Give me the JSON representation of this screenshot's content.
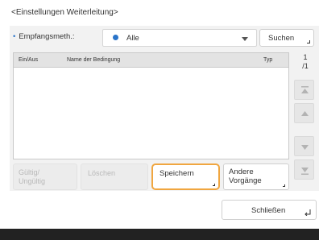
{
  "dialog": {
    "title": "<Einstellungen Weiterleitung>"
  },
  "filter": {
    "label": "Empfangsmeth.:",
    "selected_value": "Alle",
    "search_button": "Suchen"
  },
  "table": {
    "columns": [
      "Ein/Aus",
      "Name der Bedingung",
      "Typ"
    ],
    "rows": []
  },
  "pagination": {
    "current": "1",
    "total": "/1"
  },
  "actions": {
    "valid_invalid": [
      "Gültig/",
      "Ungültig"
    ],
    "delete": "Löschen",
    "save": "Speichern",
    "other_ops": [
      "Andere",
      "Vorgänge"
    ]
  },
  "close_button": "Schließen",
  "colors": {
    "accent_blue": "#2a74c9",
    "focus_orange": "#f0a640",
    "panel_bg": "#f2f2f2",
    "footer": "#222222"
  }
}
